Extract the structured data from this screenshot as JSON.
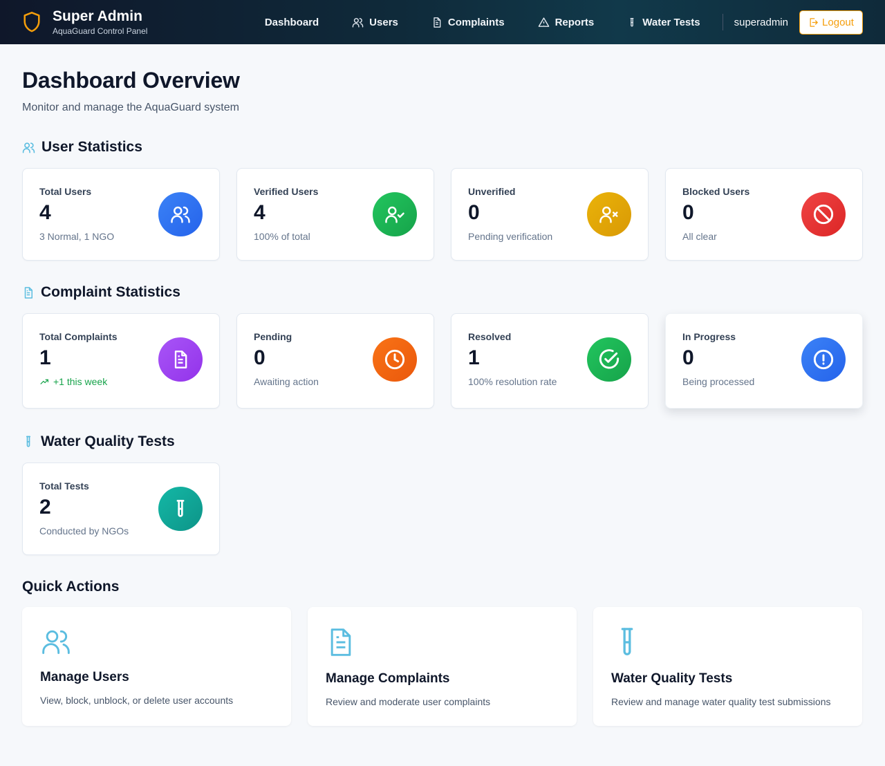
{
  "header": {
    "title": "Super Admin",
    "subtitle": "AquaGuard Control Panel",
    "nav": [
      {
        "label": "Dashboard",
        "icon": "none"
      },
      {
        "label": "Users",
        "icon": "users-icon"
      },
      {
        "label": "Complaints",
        "icon": "document-icon"
      },
      {
        "label": "Reports",
        "icon": "warning-icon"
      },
      {
        "label": "Water Tests",
        "icon": "test-tube-icon"
      }
    ],
    "username": "superadmin",
    "logout_label": "Logout"
  },
  "page": {
    "title": "Dashboard Overview",
    "subtitle": "Monitor and manage the AquaGuard system"
  },
  "user_stats": {
    "title": "User Statistics",
    "cards": [
      {
        "label": "Total Users",
        "value": "4",
        "note": "3 Normal, 1 NGO",
        "icon": "users-icon",
        "color": "#2563eb"
      },
      {
        "label": "Verified Users",
        "value": "4",
        "note": "100% of total",
        "icon": "user-check-icon",
        "color": "#16a34a"
      },
      {
        "label": "Unverified",
        "value": "0",
        "note": "Pending verification",
        "icon": "user-x-icon",
        "color": "#d99906"
      },
      {
        "label": "Blocked Users",
        "value": "0",
        "note": "All clear",
        "icon": "ban-icon",
        "color": "#dc2626"
      }
    ]
  },
  "complaint_stats": {
    "title": "Complaint Statistics",
    "cards": [
      {
        "label": "Total Complaints",
        "value": "1",
        "note": "+1 this week",
        "icon": "document-icon",
        "color": "#9333ea"
      },
      {
        "label": "Pending",
        "value": "0",
        "note": "Awaiting action",
        "icon": "clock-icon",
        "color": "#ea580c"
      },
      {
        "label": "Resolved",
        "value": "1",
        "note": "100% resolution rate",
        "icon": "check-circle-icon",
        "color": "#16a34a"
      },
      {
        "label": "In Progress",
        "value": "0",
        "note": "Being processed",
        "icon": "alert-circle-icon",
        "color": "#2563eb"
      }
    ]
  },
  "water_stats": {
    "title": "Water Quality Tests",
    "cards": [
      {
        "label": "Total Tests",
        "value": "2",
        "note": "Conducted by NGOs",
        "icon": "test-tube-icon",
        "color": "#0d9488"
      }
    ]
  },
  "quick_actions": {
    "title": "Quick Actions",
    "items": [
      {
        "name": "Manage Users",
        "desc": "View, block, unblock, or delete user accounts",
        "icon": "users-icon"
      },
      {
        "name": "Manage Complaints",
        "desc": "Review and moderate user complaints",
        "icon": "document-icon"
      },
      {
        "name": "Water Quality Tests",
        "desc": "Review and manage water quality test submissions",
        "icon": "test-tube-icon"
      }
    ]
  },
  "colors": {
    "accent": "#f59e0b",
    "icon_light": "#5bbde0"
  }
}
